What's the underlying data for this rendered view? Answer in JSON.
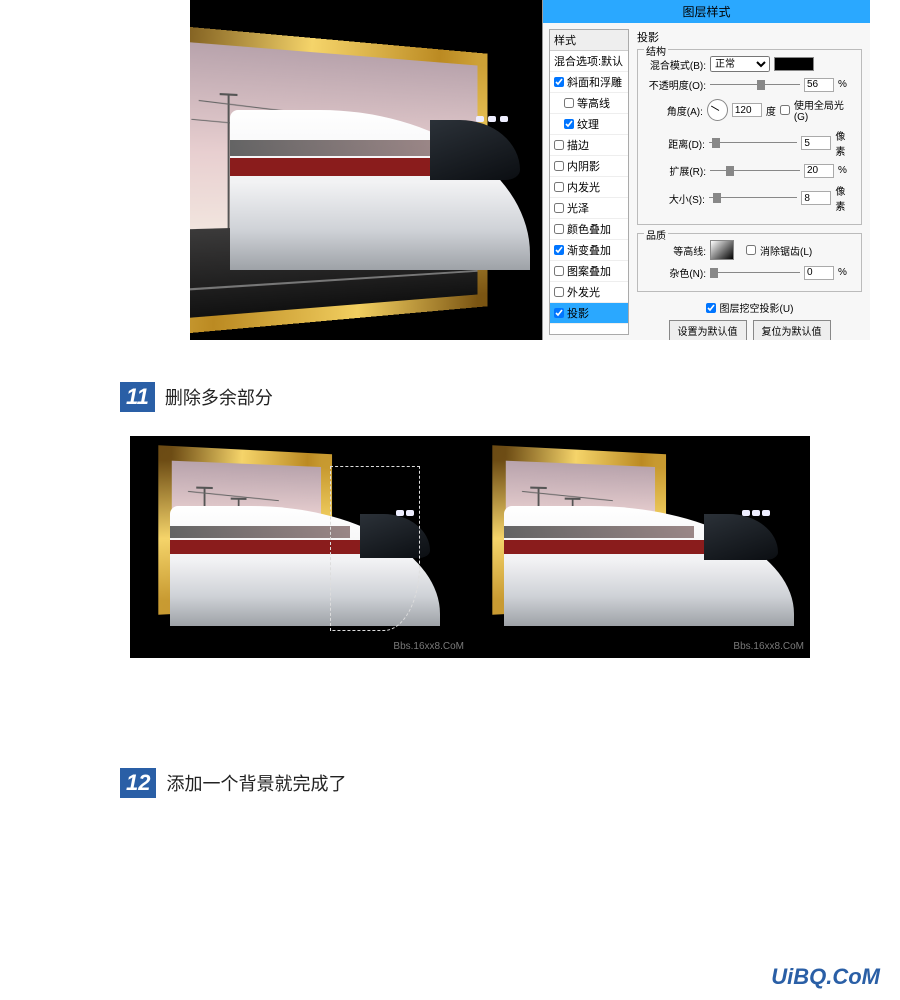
{
  "dialog": {
    "title": "图层样式",
    "side_header": "样式",
    "side_items": [
      {
        "label": "混合选项:默认",
        "checked": false,
        "selected": false,
        "noCheckbox": true
      },
      {
        "label": "斜面和浮雕",
        "checked": true,
        "selected": false
      },
      {
        "label": "等高线",
        "checked": false,
        "selected": false,
        "indent": true
      },
      {
        "label": "纹理",
        "checked": true,
        "selected": false,
        "indent": true
      },
      {
        "label": "描边",
        "checked": false,
        "selected": false
      },
      {
        "label": "内阴影",
        "checked": false,
        "selected": false
      },
      {
        "label": "内发光",
        "checked": false,
        "selected": false
      },
      {
        "label": "光泽",
        "checked": false,
        "selected": false
      },
      {
        "label": "颜色叠加",
        "checked": false,
        "selected": false
      },
      {
        "label": "渐变叠加",
        "checked": true,
        "selected": false
      },
      {
        "label": "图案叠加",
        "checked": false,
        "selected": false
      },
      {
        "label": "外发光",
        "checked": false,
        "selected": false
      },
      {
        "label": "投影",
        "checked": true,
        "selected": true
      }
    ],
    "main_title": "投影",
    "group_structure": "结构",
    "blend_mode_label": "混合模式(B):",
    "blend_mode_value": "正常",
    "opacity_label": "不透明度(O):",
    "opacity_value": "56",
    "opacity_unit": "%",
    "angle_label": "角度(A):",
    "angle_value": "120",
    "angle_unit": "度",
    "global_light_label": "使用全局光(G)",
    "global_light_checked": false,
    "distance_label": "距离(D):",
    "distance_value": "5",
    "distance_unit": "像素",
    "spread_label": "扩展(R):",
    "spread_value": "20",
    "spread_unit": "%",
    "size_label": "大小(S):",
    "size_value": "8",
    "size_unit": "像素",
    "group_quality": "品质",
    "contour_label": "等高线:",
    "antialias_label": "消除锯齿(L)",
    "antialias_checked": false,
    "noise_label": "杂色(N):",
    "noise_value": "0",
    "noise_unit": "%",
    "knockout_label": "图层挖空投影(U)",
    "knockout_checked": true,
    "btn_default": "设置为默认值",
    "btn_reset": "复位为默认值"
  },
  "step11_num": "11",
  "step11_text": "删除多余部分",
  "step12_num": "12",
  "step12_text": "添加一个背景就完成了",
  "wm_text": "Bbs.16xx8.CoM",
  "site_wm": "UiBQ.CoM"
}
